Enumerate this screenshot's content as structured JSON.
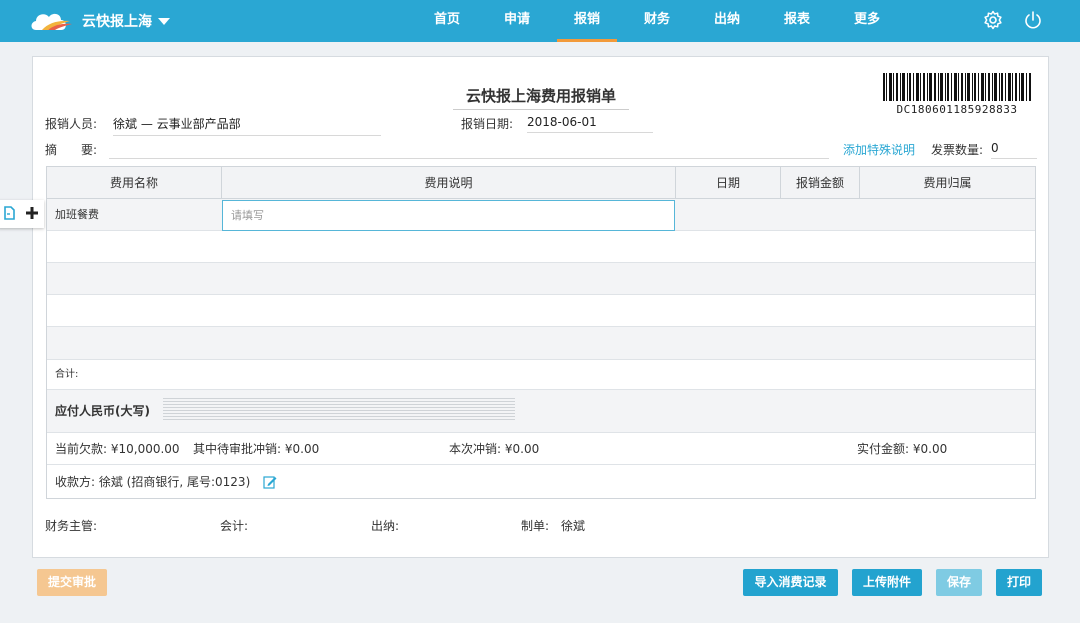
{
  "app": {
    "title": "云快报上海"
  },
  "nav": {
    "items": [
      "首页",
      "申请",
      "报销",
      "财务",
      "出纳",
      "报表",
      "更多"
    ],
    "active_index": 2
  },
  "form": {
    "title": "云快报上海费用报销单",
    "barcode_text": "DC180601185928833",
    "applicant_label": "报销人员:",
    "applicant_value": "徐斌 — 云事业部产品部",
    "date_label": "报销日期:",
    "date_value": "2018-06-01",
    "summary_label": "摘　　要:",
    "special_note_link": "添加特殊说明",
    "invoice_count_label": "发票数量:",
    "invoice_count_value": "0"
  },
  "table": {
    "headers": [
      "费用名称",
      "费用说明",
      "日期",
      "报销金额",
      "费用归属"
    ],
    "first_row_name": "加班餐费",
    "first_row_placeholder": "请填写",
    "total_label": "合计:",
    "rmb_label": "应付人民币(大写)",
    "current_debt_label": "当前欠款: ¥10,000.00",
    "pending_offset_label": "其中待审批冲销: ¥0.00",
    "this_offset_label": "本次冲销: ¥0.00",
    "actual_paid_label": "实付金额: ¥0.00",
    "payee_label": "收款方: 徐斌 (招商银行, 尾号:0123)"
  },
  "signatures": {
    "finance_manager": "财务主管:",
    "accountant": "会计:",
    "cashier": "出纳:",
    "preparer_label": "制单:",
    "preparer_value": "徐斌"
  },
  "buttons": {
    "submit": "提交审批",
    "import_records": "导入消费记录",
    "upload_attachment": "上传附件",
    "save": "保存",
    "print": "打印"
  },
  "colors": {
    "topbar": "#2aa7d3",
    "active_underline": "#f29a3a",
    "primary_button": "#23a3cf",
    "submit_button": "#f5c791"
  }
}
